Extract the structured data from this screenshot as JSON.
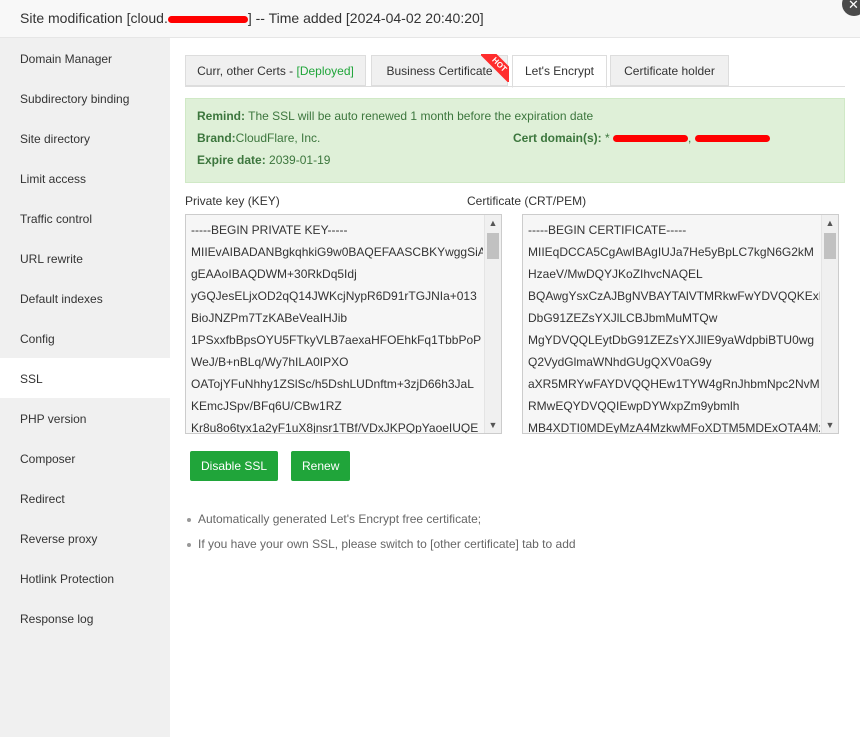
{
  "window": {
    "title_prefix": "Site modification [cloud.",
    "title_suffix": "] -- Time added [2024-04-02 20:40:20]",
    "close_icon": "close-icon"
  },
  "sidebar": {
    "items": [
      {
        "label": "Domain Manager"
      },
      {
        "label": "Subdirectory binding"
      },
      {
        "label": "Site directory"
      },
      {
        "label": "Limit access"
      },
      {
        "label": "Traffic control"
      },
      {
        "label": "URL rewrite"
      },
      {
        "label": "Default indexes"
      },
      {
        "label": "Config"
      },
      {
        "label": "SSL",
        "active": true
      },
      {
        "label": "PHP version"
      },
      {
        "label": "Composer"
      },
      {
        "label": "Redirect"
      },
      {
        "label": "Reverse proxy"
      },
      {
        "label": "Hotlink Protection"
      },
      {
        "label": "Response log"
      }
    ]
  },
  "tabs": [
    {
      "label": "Curr, other Certs - ",
      "status": "[Deployed]"
    },
    {
      "label": "Business Certificate",
      "badge": "HOT"
    },
    {
      "label": "Let's Encrypt",
      "active": true
    },
    {
      "label": "Certificate holder"
    }
  ],
  "notice": {
    "remind_label": "Remind:",
    "remind_text": " The SSL will be auto renewed 1 month before the expiration date",
    "brand_label": "Brand:",
    "brand_value": "CloudFlare, Inc.",
    "domains_label": "Cert domain(s):",
    "domains_prefix": " * ",
    "domains_sep": ", ",
    "expire_label": "Expire date:",
    "expire_value": " 2039-01-19"
  },
  "private_key": {
    "label": "Private key (KEY)",
    "lines": [
      "-----BEGIN PRIVATE KEY-----",
      "MIIEvAIBADANBgkqhkiG9w0BAQEFAASCBKYwggSiA",
      "gEAAoIBAQDWM+30RkDq5Idj",
      "yGQJesELjxOD2qQ14JWKcjNypR6D91rTGJNIa+013",
      "BioJNZPm7TzKABeVeaIHJib",
      "1PSxxfbBpsOYU5FTkyVLB7aexaHFOEhkFq1TbbPoP",
      "WeJ/B+nBLq/Wy7hILA0IPXO",
      "OATojYFuNhhy1ZSlSc/h5DshLUDnftm+3zjD66h3JaL",
      "KEmcJSpv/BFq6U/CBw1RZ",
      "Kr8u8o6tyx1a2yF1uX8jnsr1TBf/VDxJKPQpYaoeIUQE"
    ]
  },
  "certificate": {
    "label": "Certificate (CRT/PEM)",
    "lines": [
      "-----BEGIN CERTIFICATE-----",
      "MIIEqDCCA5CgAwIBAgIUJa7He5yBpLC7kgN6G2kM",
      "HzaeV/MwDQYJKoZIhvcNAQEL",
      "BQAwgYsxCzAJBgNVBAYTAlVTMRkwFwYDVQQKExB",
      "DbG91ZEZsYXJlLCBJbmMuMTQw",
      "MgYDVQQLEytDbG91ZEZsYXJlIE9yaWdpbiBTU0wg",
      "Q2VydGlmaWNhdGUgQXV0aG9y",
      "aXR5MRYwFAYDVQQHEw1TYW4gRnJhbmNpc2NvM",
      "RMwEQYDVQQIEwpDYWxpZm9ybmlh",
      "MB4XDTI0MDEyMzA4MzkwMFoXDTM5MDExOTA4Mzk"
    ]
  },
  "buttons": {
    "disable_ssl": "Disable SSL",
    "renew": "Renew"
  },
  "tips": [
    "Automatically generated Let's Encrypt free certificate;",
    "If you have your own SSL, please switch to [other certificate] tab to add"
  ],
  "colors": {
    "accent": "#20a53a",
    "notice_bg": "#dff0d8",
    "notice_text": "#3c763d",
    "redaction": "#ff0000"
  }
}
